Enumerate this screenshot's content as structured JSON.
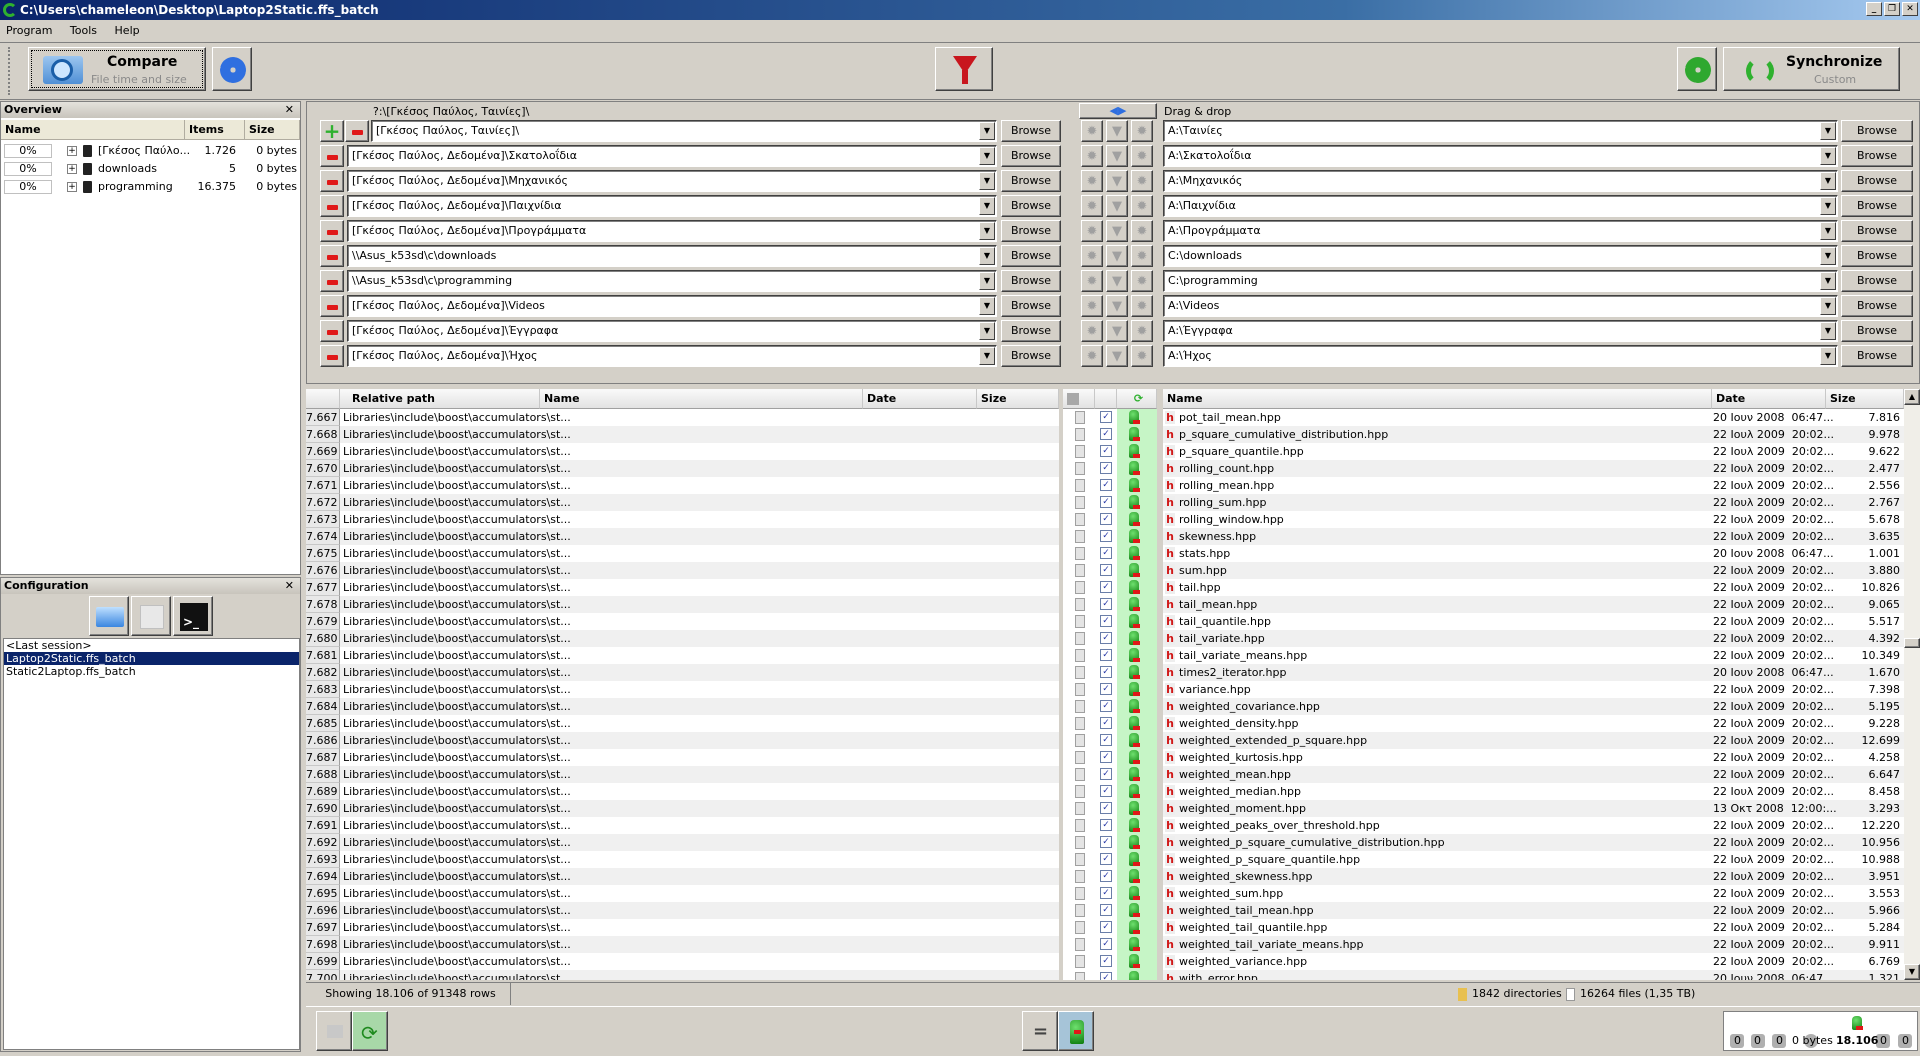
{
  "window": {
    "title": "C:\\Users\\chameleon\\Desktop\\Laptop2Static.ffs_batch"
  },
  "menu": [
    "Program",
    "Tools",
    "Help"
  ],
  "toolbar": {
    "compare_label": "Compare",
    "compare_sub": "File time and size",
    "sync_label": "Synchronize",
    "sync_sub": "Custom"
  },
  "overview": {
    "title": "Overview",
    "columns": [
      "Name",
      "Items",
      "Size"
    ],
    "rows": [
      {
        "pct": "0%",
        "name": "[Γκέσος Παύλο...",
        "items": "1.726",
        "size": "0 bytes"
      },
      {
        "pct": "0%",
        "name": "downloads",
        "items": "5",
        "size": "0 bytes"
      },
      {
        "pct": "0%",
        "name": "programming",
        "items": "16.375",
        "size": "0 bytes"
      }
    ]
  },
  "configuration": {
    "title": "Configuration",
    "items": [
      "<Last session>",
      "Laptop2Static.ffs_batch",
      "Static2Laptop.ffs_batch"
    ],
    "selected": 1
  },
  "folder_pairs": {
    "left_header": "?:\\[Γκέσος Παύλος, Ταινίες]\\",
    "right_header": "Drag & drop",
    "browse_label": "Browse",
    "pairs": [
      {
        "left": "[Γκέσος Παύλος, Ταινίες]\\",
        "right": "A:\\Ταινίες"
      },
      {
        "left": "[Γκέσος Παύλος, Δεδομένα]\\Σκατολοΐδια",
        "right": "A:\\Σκατολοΐδια"
      },
      {
        "left": "[Γκέσος Παύλος, Δεδομένα]\\Μηχανικός",
        "right": "A:\\Μηχανικός"
      },
      {
        "left": "[Γκέσος Παύλος, Δεδομένα]\\Παιχνίδια",
        "right": "A:\\Παιχνίδια"
      },
      {
        "left": "[Γκέσος Παύλος, Δεδομένα]\\Προγράμματα",
        "right": "A:\\Προγράμματα"
      },
      {
        "left": "\\\\Asus_k53sd\\c\\downloads",
        "right": "C:\\downloads"
      },
      {
        "left": "\\\\Asus_k53sd\\c\\programming",
        "right": "C:\\programming"
      },
      {
        "left": "[Γκέσος Παύλος, Δεδομένα]\\Videos",
        "right": "A:\\Videos"
      },
      {
        "left": "[Γκέσος Παύλος, Δεδομένα]\\Έγγραφα",
        "right": "A:\\Έγγραφα"
      },
      {
        "left": "[Γκέσος Παύλος, Δεδομένα]\\Ήχος",
        "right": "A:\\Ήχος"
      }
    ]
  },
  "grid": {
    "left_columns": [
      "Relative path",
      "Name",
      "Date",
      "Size"
    ],
    "right_columns": [
      "Name",
      "Date",
      "Size"
    ],
    "rel_path": "Libraries\\include\\boost\\accumulators\\st...",
    "rows": [
      [
        "7.667",
        "pot_tail_mean.hpp",
        "20 Ιουν 2008  06:47...",
        "7.816"
      ],
      [
        "7.668",
        "p_square_cumulative_distribution.hpp",
        "22 Ιουλ 2009  20:02...",
        "9.978"
      ],
      [
        "7.669",
        "p_square_quantile.hpp",
        "22 Ιουλ 2009  20:02...",
        "9.622"
      ],
      [
        "7.670",
        "rolling_count.hpp",
        "22 Ιουλ 2009  20:02...",
        "2.477"
      ],
      [
        "7.671",
        "rolling_mean.hpp",
        "22 Ιουλ 2009  20:02...",
        "2.556"
      ],
      [
        "7.672",
        "rolling_sum.hpp",
        "22 Ιουλ 2009  20:02...",
        "2.767"
      ],
      [
        "7.673",
        "rolling_window.hpp",
        "22 Ιουλ 2009  20:02...",
        "5.678"
      ],
      [
        "7.674",
        "skewness.hpp",
        "22 Ιουλ 2009  20:02...",
        "3.635"
      ],
      [
        "7.675",
        "stats.hpp",
        "20 Ιουν 2008  06:47...",
        "1.001"
      ],
      [
        "7.676",
        "sum.hpp",
        "22 Ιουλ 2009  20:02...",
        "3.880"
      ],
      [
        "7.677",
        "tail.hpp",
        "22 Ιουλ 2009  20:02...",
        "10.826"
      ],
      [
        "7.678",
        "tail_mean.hpp",
        "22 Ιουλ 2009  20:02...",
        "9.065"
      ],
      [
        "7.679",
        "tail_quantile.hpp",
        "22 Ιουλ 2009  20:02...",
        "5.517"
      ],
      [
        "7.680",
        "tail_variate.hpp",
        "22 Ιουλ 2009  20:02...",
        "4.392"
      ],
      [
        "7.681",
        "tail_variate_means.hpp",
        "22 Ιουλ 2009  20:02...",
        "10.349"
      ],
      [
        "7.682",
        "times2_iterator.hpp",
        "20 Ιουν 2008  06:47...",
        "1.670"
      ],
      [
        "7.683",
        "variance.hpp",
        "22 Ιουλ 2009  20:02...",
        "7.398"
      ],
      [
        "7.684",
        "weighted_covariance.hpp",
        "22 Ιουλ 2009  20:02...",
        "5.195"
      ],
      [
        "7.685",
        "weighted_density.hpp",
        "22 Ιουλ 2009  20:02...",
        "9.228"
      ],
      [
        "7.686",
        "weighted_extended_p_square.hpp",
        "22 Ιουλ 2009  20:02...",
        "12.699"
      ],
      [
        "7.687",
        "weighted_kurtosis.hpp",
        "22 Ιουλ 2009  20:02...",
        "4.258"
      ],
      [
        "7.688",
        "weighted_mean.hpp",
        "22 Ιουλ 2009  20:02...",
        "6.647"
      ],
      [
        "7.689",
        "weighted_median.hpp",
        "22 Ιουλ 2009  20:02...",
        "8.458"
      ],
      [
        "7.690",
        "weighted_moment.hpp",
        "13 Οκτ 2008  12:00:...",
        "3.293"
      ],
      [
        "7.691",
        "weighted_peaks_over_threshold.hpp",
        "22 Ιουλ 2009  20:02...",
        "12.220"
      ],
      [
        "7.692",
        "weighted_p_square_cumulative_distribution.hpp",
        "22 Ιουλ 2009  20:02...",
        "10.956"
      ],
      [
        "7.693",
        "weighted_p_square_quantile.hpp",
        "22 Ιουλ 2009  20:02...",
        "10.988"
      ],
      [
        "7.694",
        "weighted_skewness.hpp",
        "22 Ιουλ 2009  20:02...",
        "3.951"
      ],
      [
        "7.695",
        "weighted_sum.hpp",
        "22 Ιουλ 2009  20:02...",
        "3.553"
      ],
      [
        "7.696",
        "weighted_tail_mean.hpp",
        "22 Ιουλ 2009  20:02...",
        "5.966"
      ],
      [
        "7.697",
        "weighted_tail_quantile.hpp",
        "22 Ιουλ 2009  20:02...",
        "5.284"
      ],
      [
        "7.698",
        "weighted_tail_variate_means.hpp",
        "22 Ιουλ 2009  20:02...",
        "9.911"
      ],
      [
        "7.699",
        "weighted_variance.hpp",
        "22 Ιουλ 2009  20:02...",
        "6.769"
      ],
      [
        "7.700",
        "with_error.hpp",
        "20 Ιουν 2008  06:47...",
        "1.321"
      ]
    ]
  },
  "status": {
    "showing": "Showing 18.106 of 91348 rows",
    "directories": "1842 directories",
    "files": "16264 files (1,35 TB)"
  },
  "stats": {
    "values": [
      "0",
      "0",
      "0",
      "0 bytes",
      "18.106",
      "0",
      "0"
    ]
  },
  "colors": {
    "accent": "#0a246a",
    "action_column": "#c6f5c6",
    "delete": "#e01818"
  }
}
